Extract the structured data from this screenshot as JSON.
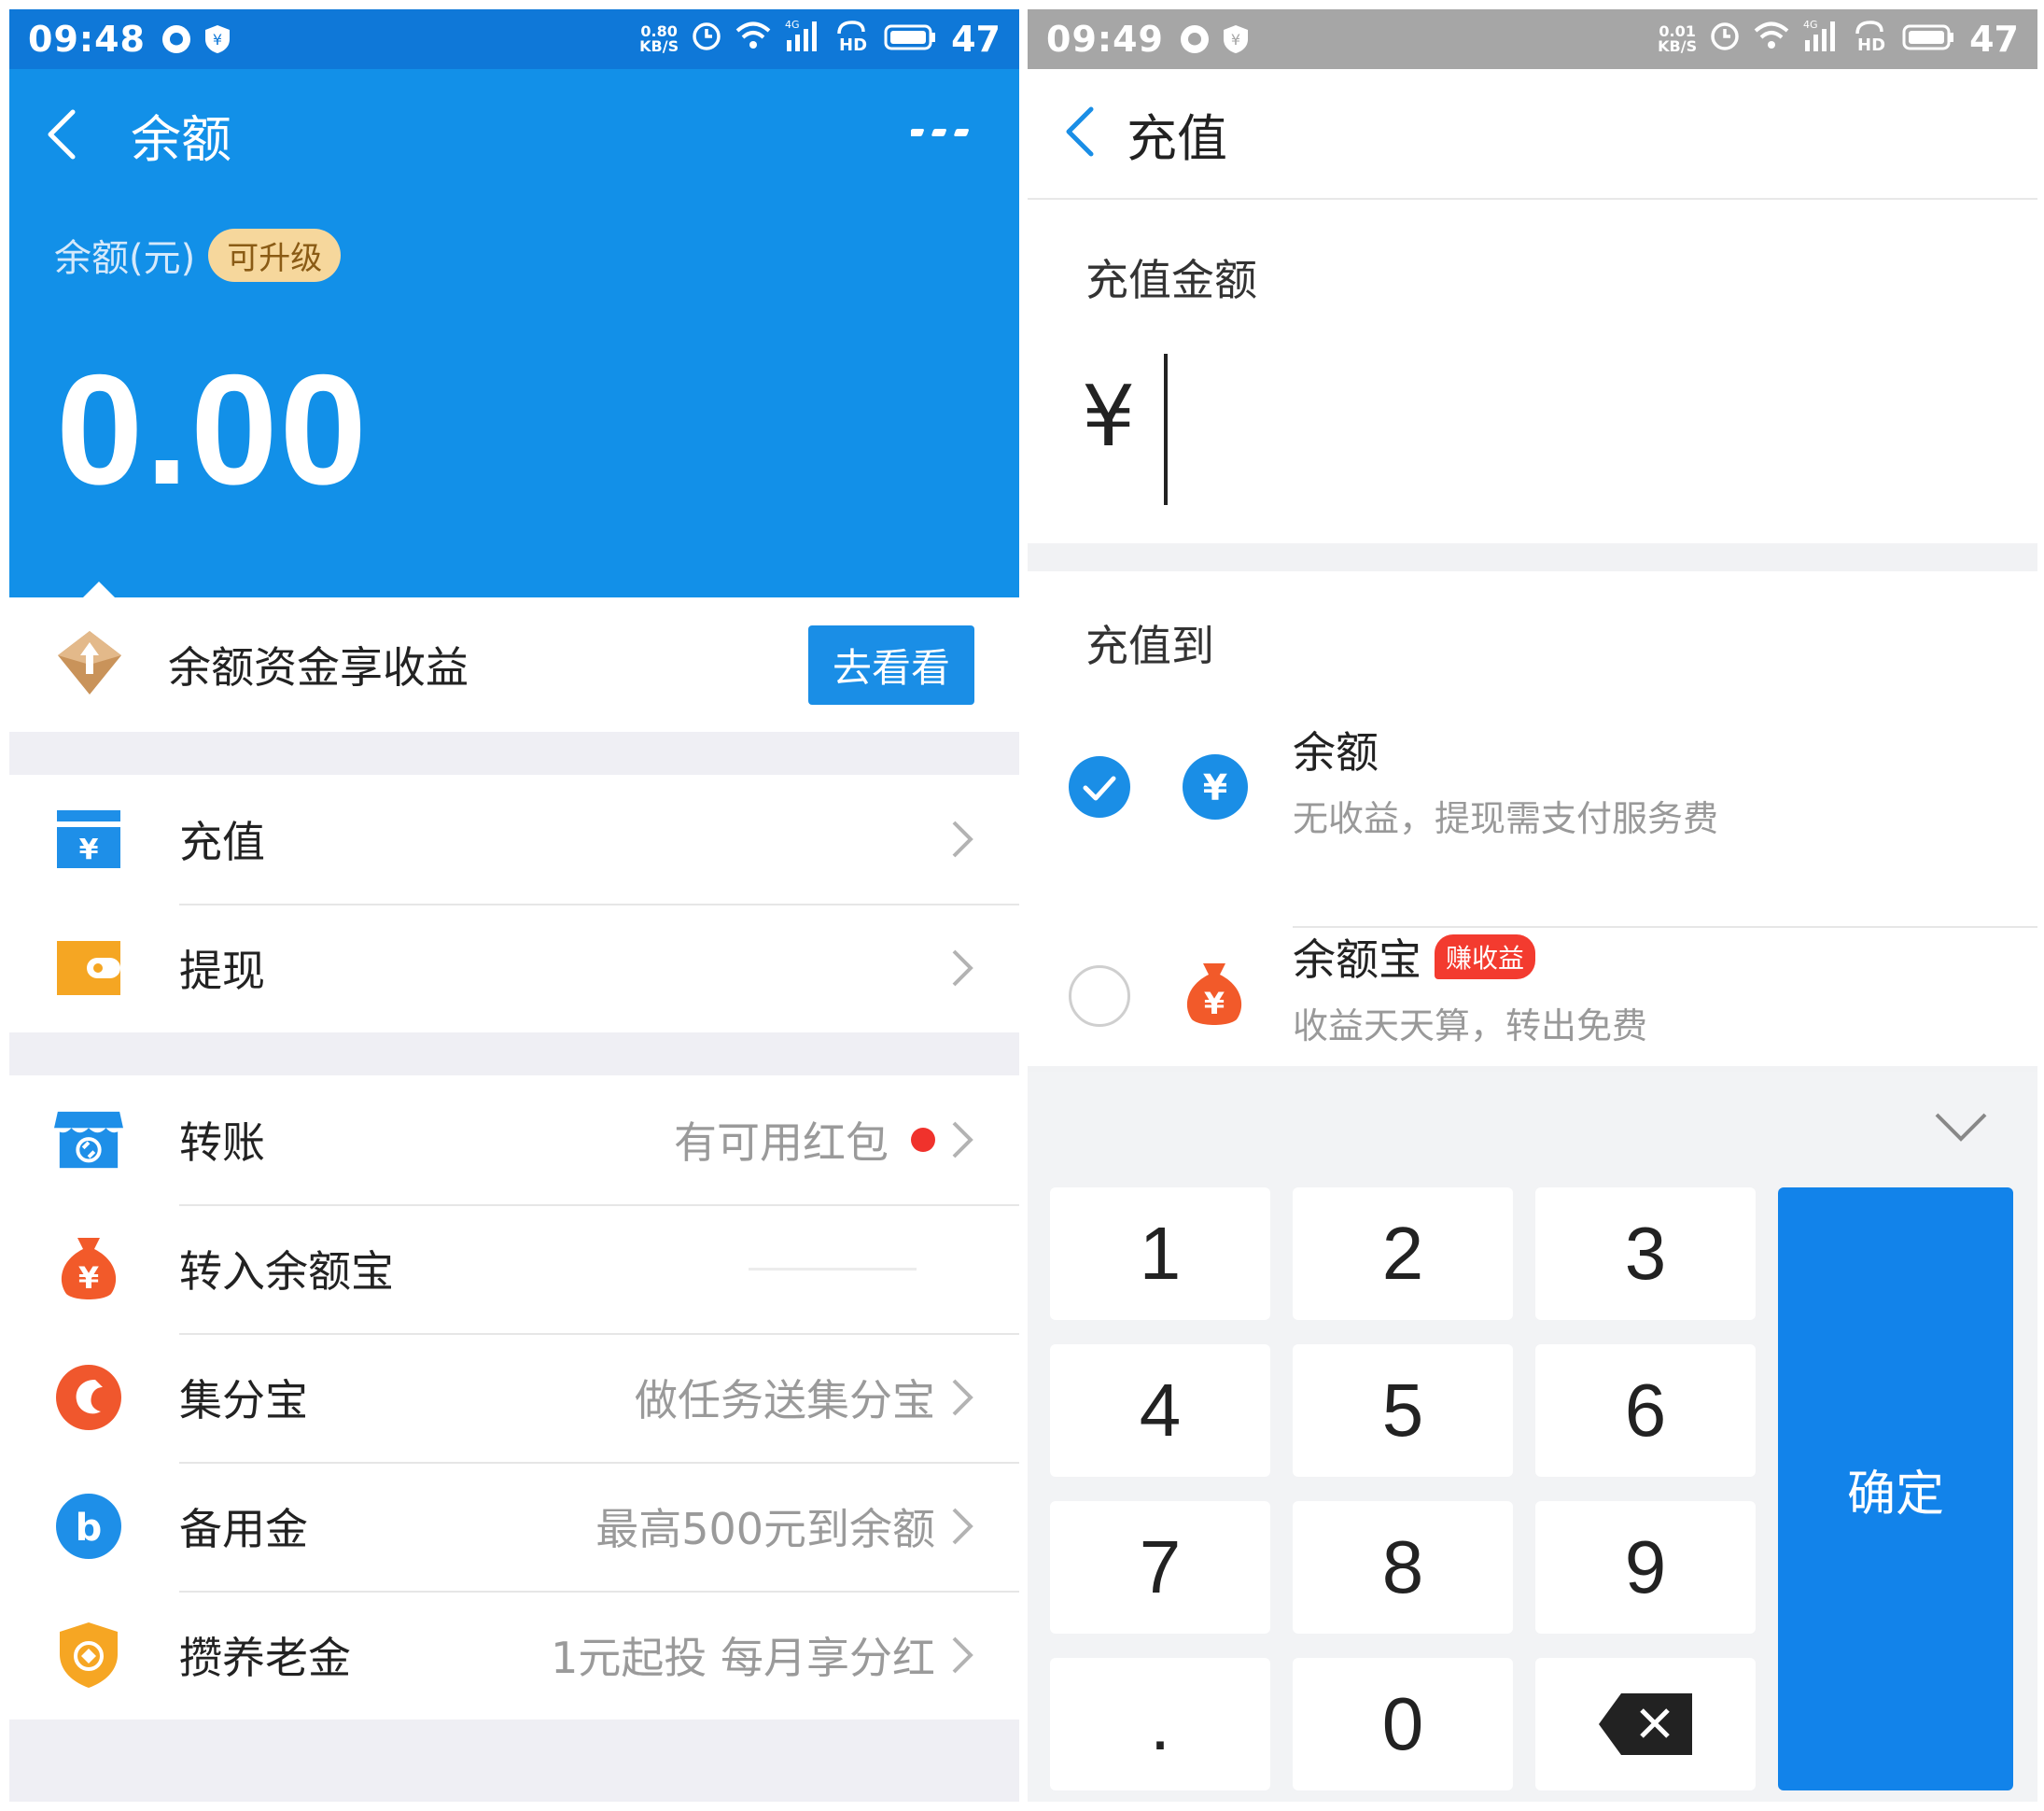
{
  "left": {
    "status": {
      "time": "09:48",
      "speed_top": "0.80",
      "speed_unit": "KB/S",
      "net": "4G",
      "hd": "HD",
      "battery": "47"
    },
    "nav": {
      "title": "余额"
    },
    "balance": {
      "label": "余额(元)",
      "badge": "可升级",
      "amount": "0.00"
    },
    "promo": {
      "text": "余额资金享收益",
      "button": "去看看"
    },
    "group1": [
      {
        "label": "充值"
      },
      {
        "label": "提现"
      }
    ],
    "group2": [
      {
        "label": "转账",
        "value": "有可用红包"
      },
      {
        "label": "转入余额宝"
      },
      {
        "label": "集分宝",
        "value": "做任务送集分宝"
      },
      {
        "label": "备用金",
        "value": "最高500元到余额"
      },
      {
        "label": "攒养老金",
        "value": "1元起投 每月享分红"
      }
    ]
  },
  "right": {
    "status": {
      "time": "09:49",
      "speed_top": "0.01",
      "speed_unit": "KB/S",
      "net": "4G",
      "hd": "HD",
      "battery": "47"
    },
    "nav": {
      "title": "充值"
    },
    "amount": {
      "label": "充值金额",
      "currency": "¥"
    },
    "target": {
      "label": "充值到",
      "options": [
        {
          "title": "余额",
          "desc": "无收益，提现需支付服务费",
          "selected": true
        },
        {
          "title": "余额宝",
          "tag": "赚收益",
          "desc": "收益天天算，转出免费",
          "selected": false
        }
      ]
    },
    "keypad": {
      "keys": [
        "1",
        "2",
        "3",
        "4",
        "5",
        "6",
        "7",
        "8",
        "9",
        ".",
        "0"
      ],
      "confirm": "确定"
    }
  },
  "colors": {
    "primary_blue": "#1290e8",
    "accent_red": "#f0322c",
    "gold_badge": "#f6d79c"
  }
}
